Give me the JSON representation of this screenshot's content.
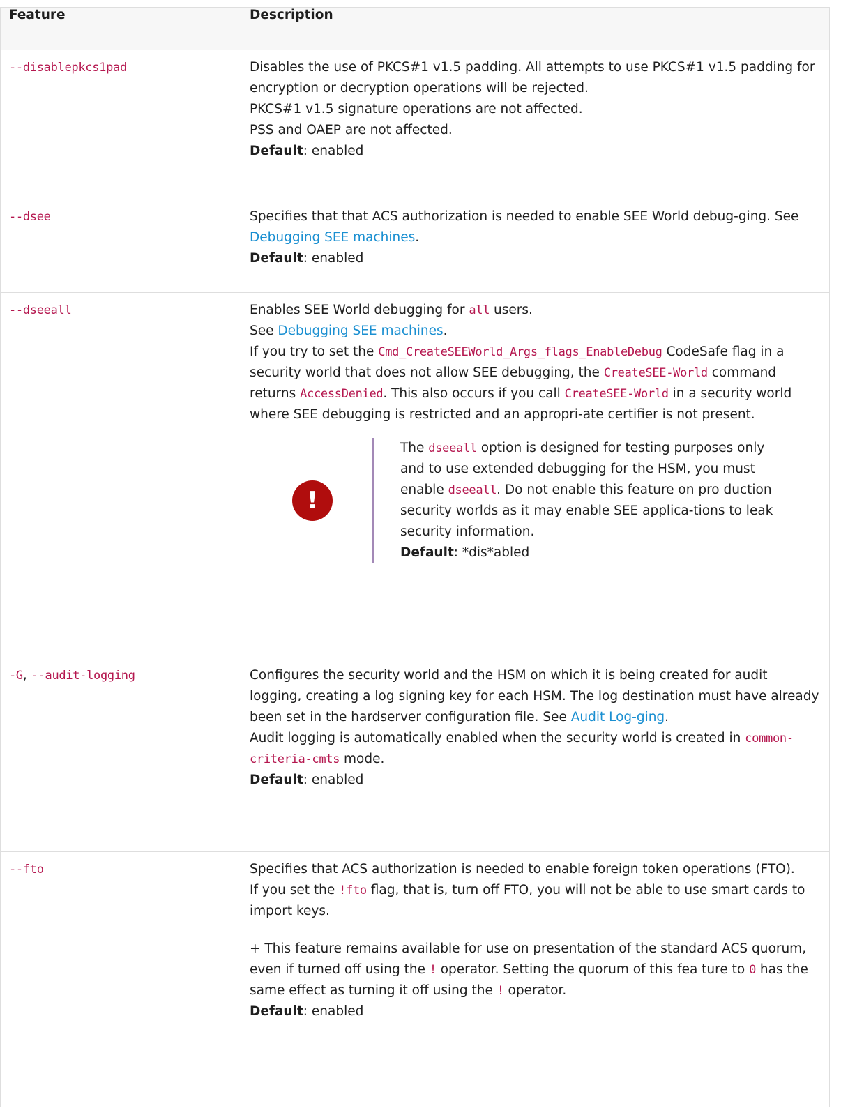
{
  "header": {
    "feature": "Feature",
    "description": "Description"
  },
  "rows": [
    {
      "feature": "--disablepkcs1pad",
      "lines": [
        "Disables the use of PKCS#1 v1.5 padding. All attempts to use PKCS#1 v1.5 padding for encryption or decryption operations will be rejected.",
        "PKCS#1 v1.5 signature operations are not affected.",
        "PSS and OAEP are not affected."
      ],
      "default_label": "Default",
      "default_value": ": enabled"
    },
    {
      "feature": "--dsee",
      "text_before_link": "Specifies that that ACS authorization is needed to enable SEE World debug-ging. See ",
      "link": "Debugging SEE machines",
      "text_after_link": ".",
      "default_label": "Default",
      "default_value": ": enabled"
    },
    {
      "feature": "--dseeall",
      "l1_a": "Enables SEE World debugging for ",
      "l1_code": "all",
      "l1_b": " users.",
      "l2_a": "See ",
      "l2_link": "Debugging SEE machines",
      "l2_b": ".",
      "p_a": "If you try to set the ",
      "p_code1": "Cmd_CreateSEEWorld_Args_flags_EnableDebug",
      "p_b": " CodeSafe flag in a security world that does not allow SEE debugging, the ",
      "p_code2": "CreateSEE-World",
      "p_c": " command returns ",
      "p_code3": "AccessDenied",
      "p_d": ". This also occurs if you call ",
      "p_code4": "CreateSEE-World",
      "p_e": " in a security world where SEE debugging is restricted and an appropri-ate certifier is not present.",
      "admonition": {
        "icon": "error-icon",
        "t_a": "The ",
        "t_code1": "dseeall",
        "t_b": " option is designed for testing purposes only and to use extended debugging for the HSM, you must enable ",
        "t_code2": "dseeall",
        "t_c": ". Do not enable this feature on pro duction security worlds as it may enable SEE applica-tions to leak security information.",
        "default_label": "Default",
        "default_value": ": *dis*abled"
      }
    },
    {
      "feature_short": "-G",
      "feature_sep": ", ",
      "feature_long": "--audit-logging",
      "p1_a": "Configures the security world and the HSM on which it is being created for audit logging, creating a log signing key for each HSM. The log destination must have already been set in the hardserver configuration file. See ",
      "p1_link": "Audit Log-ging",
      "p1_b": ".",
      "p2_a": "Audit logging is automatically enabled when the security world is created in ",
      "p2_code": "common-criteria-cmts",
      "p2_b": " mode.",
      "default_label": "Default",
      "default_value": ": enabled"
    },
    {
      "feature": "--fto",
      "p1": "Specifies that ACS authorization is needed to enable foreign token operations (FTO).",
      "p2_a": "If you set the ",
      "p2_code": "!fto",
      "p2_b": " flag, that is, turn off FTO, you will not be able to use smart cards to import keys.",
      "p3_a": "+ This feature remains available for use on presentation of the standard ACS quorum, even if turned off using the ",
      "p3_code1": "!",
      "p3_b": " operator. Setting the quorum of this fea ture to ",
      "p3_code2": "0",
      "p3_c": " has the same effect as turning it off using the ",
      "p3_code3": "!",
      "p3_d": " operator.",
      "default_label": "Default",
      "default_value": ": enabled"
    }
  ]
}
